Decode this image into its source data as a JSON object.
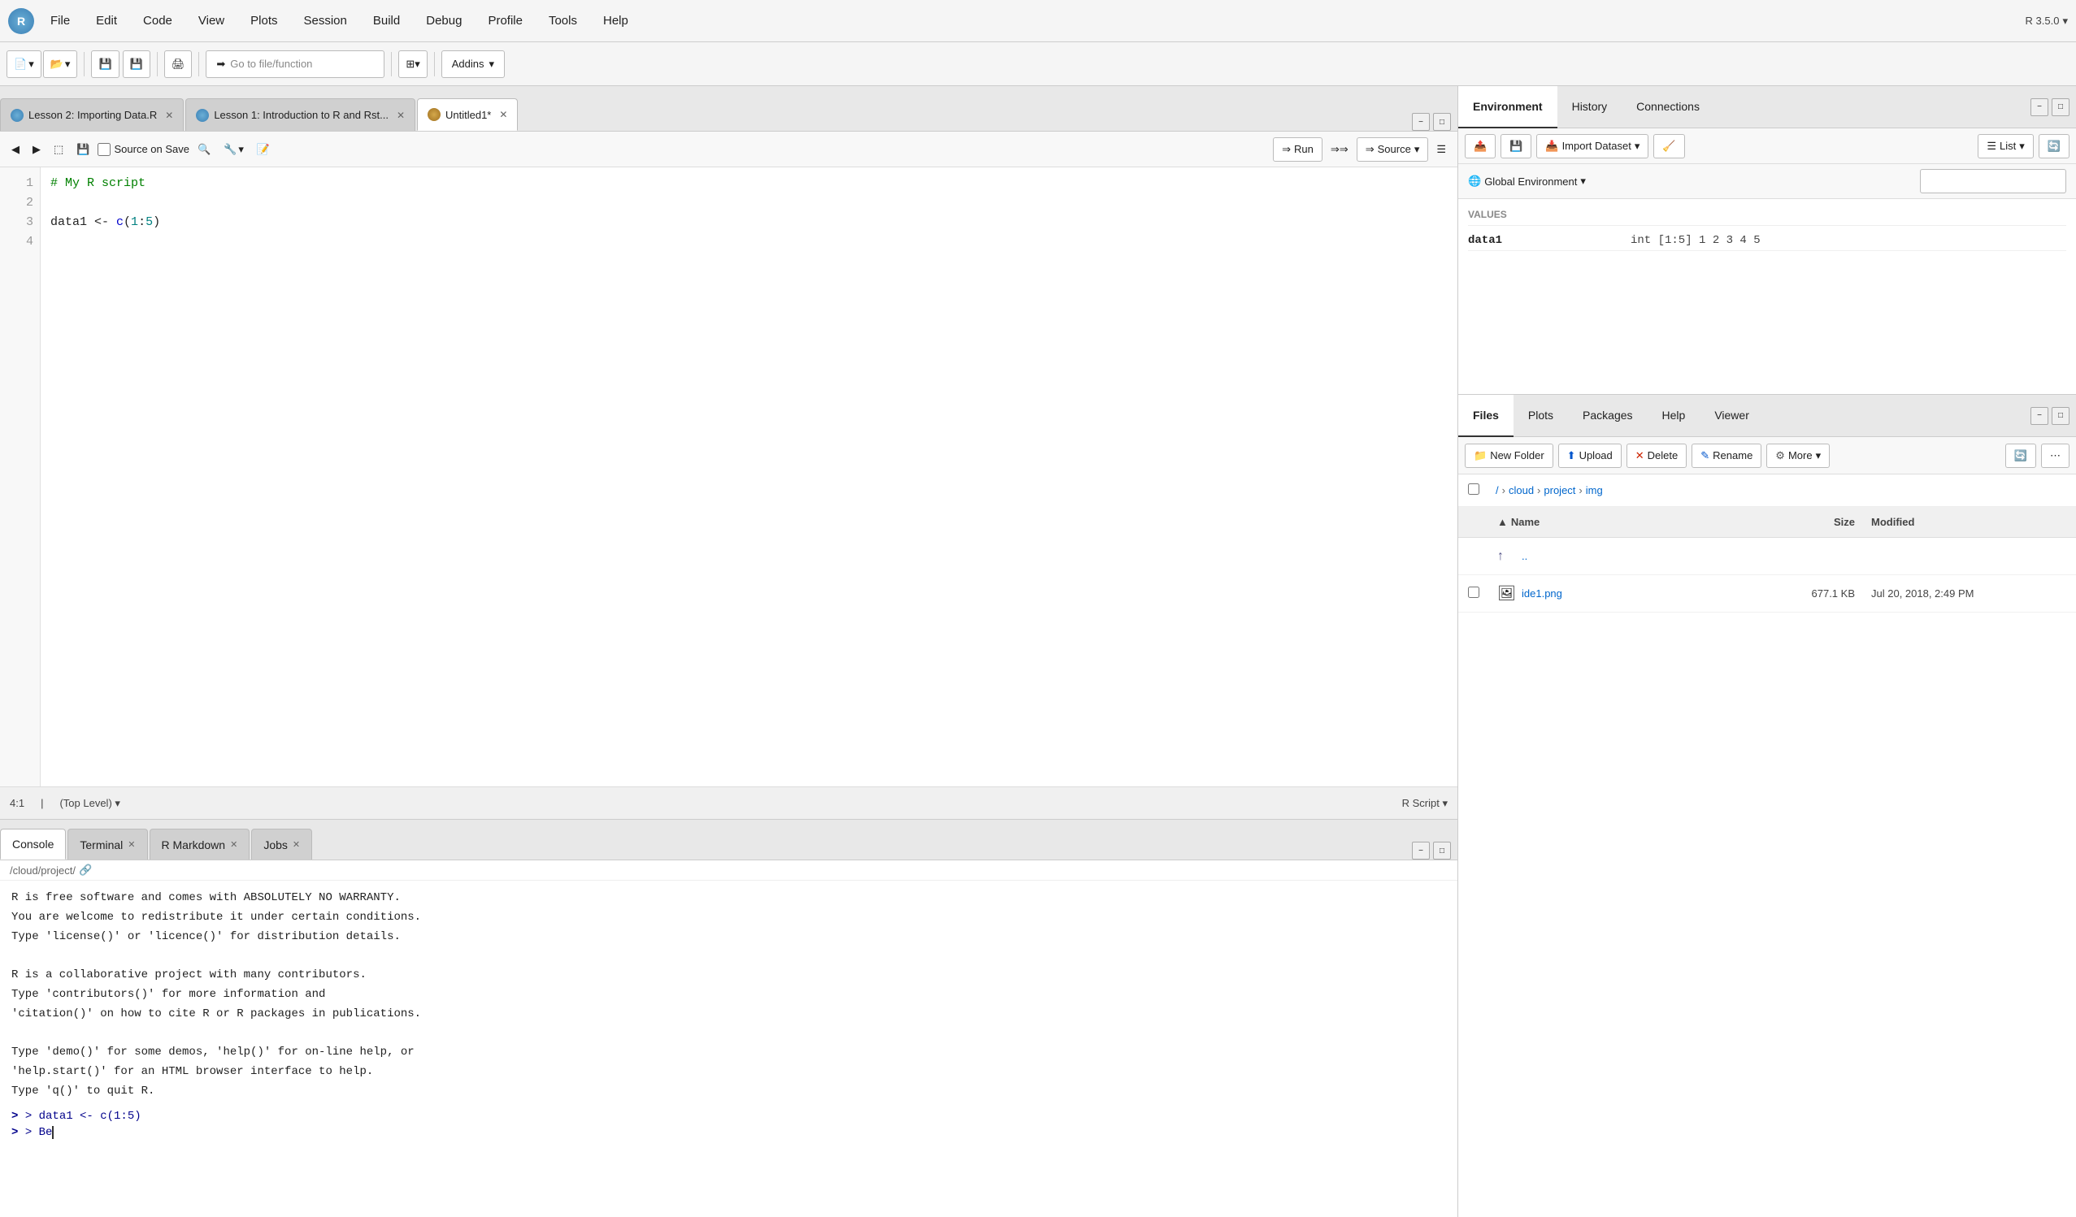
{
  "menubar": {
    "items": [
      "File",
      "Edit",
      "Code",
      "View",
      "Plots",
      "Session",
      "Build",
      "Debug",
      "Profile",
      "Tools",
      "Help"
    ]
  },
  "toolbar": {
    "go_to_file_placeholder": "Go to file/function",
    "addins_label": "Addins",
    "r_version": "R 3.5.0"
  },
  "editor": {
    "tabs": [
      {
        "label": "Lesson 2: Importing Data.R",
        "type": "r",
        "active": false
      },
      {
        "label": "Lesson 1: Introduction to R and Rst...",
        "type": "r",
        "active": false
      },
      {
        "label": "Untitled1*",
        "type": "u",
        "active": true
      }
    ],
    "source_on_save_label": "Source on Save",
    "run_label": "Run",
    "source_label": "Source",
    "lines": [
      {
        "num": "1",
        "content": "# My R script",
        "type": "comment"
      },
      {
        "num": "2",
        "content": "",
        "type": "empty"
      },
      {
        "num": "3",
        "content": "data1 <- c(1:5)",
        "type": "code"
      },
      {
        "num": "4",
        "content": "",
        "type": "empty"
      }
    ],
    "status": {
      "position": "4:1",
      "level": "(Top Level)",
      "script_type": "R Script"
    }
  },
  "console": {
    "tabs": [
      {
        "label": "Console",
        "active": true,
        "closable": false
      },
      {
        "label": "Terminal",
        "active": false,
        "closable": true
      },
      {
        "label": "R Markdown",
        "active": false,
        "closable": true
      },
      {
        "label": "Jobs",
        "active": false,
        "closable": true
      }
    ],
    "path": "/cloud/project/",
    "startup_text": "R is free software and comes with ABSOLUTELY NO WARRANTY.\nYou are welcome to redistribute it under certain conditions.\nType 'license()' or 'licence()' for distribution details.\n\nR is a collaborative project with many contributors.\nType 'contributors()' for more information and\n'citation()' on how to cite R or R packages in publications.\n\nType 'demo()' for some demos, 'help()' for on-line help, or\n'help.start()' for an HTML browser interface to help.\nType 'q()' to quit R.",
    "commands": [
      "> data1 <- c(1:5)",
      "> Be"
    ]
  },
  "environment": {
    "tabs": [
      "Environment",
      "History",
      "Connections"
    ],
    "active_tab": "Environment",
    "import_dataset_label": "Import Dataset",
    "list_label": "List",
    "global_env_label": "Global Environment",
    "search_placeholder": "",
    "values_header": "Values",
    "values": [
      {
        "name": "data1",
        "description": "int [1:5] 1 2 3 4 5"
      }
    ]
  },
  "files": {
    "tabs": [
      "Files",
      "Plots",
      "Packages",
      "Help",
      "Viewer"
    ],
    "active_tab": "Files",
    "toolbar": {
      "new_folder": "New Folder",
      "upload": "Upload",
      "delete": "Delete",
      "rename": "Rename",
      "more": "More"
    },
    "breadcrumb": [
      "/",
      "cloud",
      "project",
      "img"
    ],
    "columns": {
      "name": "Name",
      "size": "Size",
      "modified": "Modified"
    },
    "items": [
      {
        "name": "..",
        "type": "parent",
        "size": "",
        "modified": ""
      },
      {
        "name": "ide1.png",
        "type": "file",
        "size": "677.1 KB",
        "modified": "Jul 20, 2018, 2:49 PM"
      }
    ]
  }
}
